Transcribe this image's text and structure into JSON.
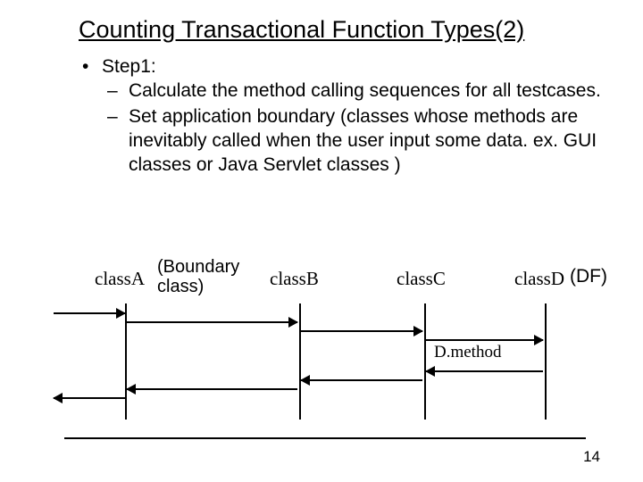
{
  "title": "Counting Transactional Function Types(2)",
  "step_label": "Step1:",
  "step1_items": [
    "Calculate the method calling sequences for all testcases.",
    "Set application boundary (classes whose methods are inevitably called when the user input some data. ex. GUI classes or Java Servlet classes )"
  ],
  "diagram": {
    "a": "classA",
    "a_note_l1": "(Boundary",
    "a_note_l2": "class)",
    "b": "classB",
    "c": "classC",
    "d": "classD",
    "df": "(DF)",
    "d_method": "D.method"
  },
  "page_number": "14"
}
